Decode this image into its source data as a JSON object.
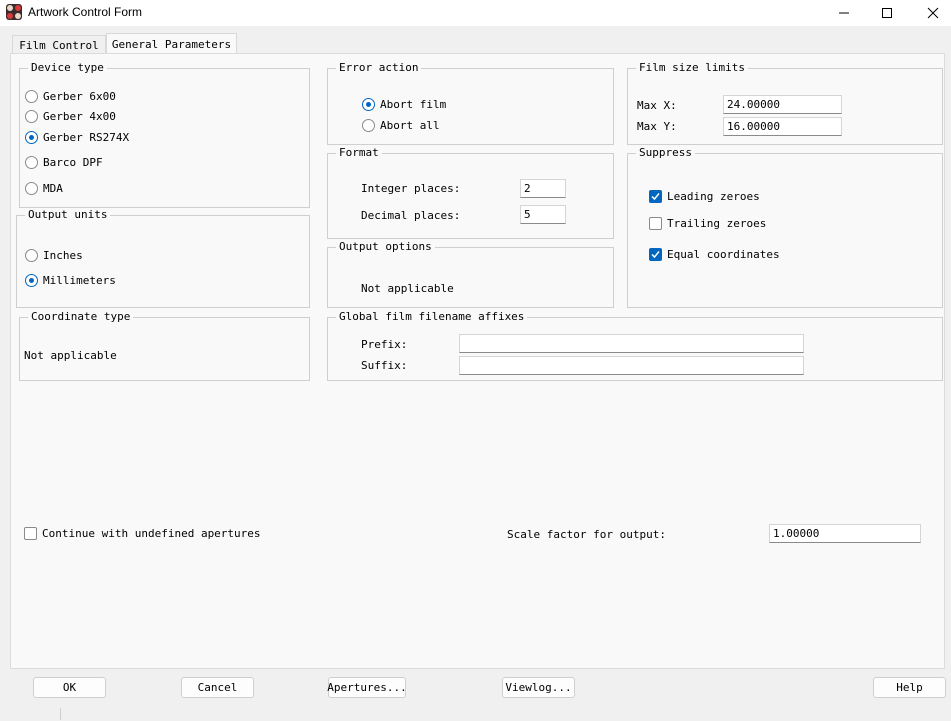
{
  "window": {
    "title": "Artwork Control Form",
    "icon": "app-logo-icon",
    "controls": [
      "minimize-icon",
      "maximize-icon",
      "close-icon"
    ]
  },
  "tabs": [
    {
      "label": "Film Control",
      "active": false
    },
    {
      "label": "General Parameters",
      "active": true
    }
  ],
  "device_type": {
    "label": "Device type",
    "options": [
      "Gerber 6x00",
      "Gerber 4x00",
      "Gerber RS274X",
      "Barco DPF",
      "MDA"
    ],
    "selected": "Gerber RS274X"
  },
  "output_units": {
    "label": "Output units",
    "options": [
      "Inches",
      "Millimeters"
    ],
    "selected": "Millimeters"
  },
  "coordinate_type": {
    "label": "Coordinate type",
    "value": "Not applicable"
  },
  "error_action": {
    "label": "Error action",
    "options": [
      "Abort film",
      "Abort all"
    ],
    "selected": "Abort film"
  },
  "format": {
    "label": "Format",
    "integer_label": "Integer places:",
    "integer_value": "2",
    "decimal_label": "Decimal places:",
    "decimal_value": "5"
  },
  "output_options": {
    "label": "Output options",
    "value": "Not applicable"
  },
  "film_size": {
    "label": "Film size limits",
    "max_x_label": "Max X:",
    "max_x_value": "24.00000",
    "max_y_label": "Max Y:",
    "max_y_value": "16.00000"
  },
  "suppress": {
    "label": "Suppress",
    "leading_label": "Leading zeroes",
    "leading_checked": true,
    "trailing_label": "Trailing zeroes",
    "trailing_checked": false,
    "equal_label": "Equal coordinates",
    "equal_checked": true
  },
  "affixes": {
    "label": "Global film filename affixes",
    "prefix_label": "Prefix:",
    "prefix_value": "",
    "suffix_label": "Suffix:",
    "suffix_value": ""
  },
  "continue_undefined": {
    "label": "Continue with undefined apertures",
    "checked": false
  },
  "scale": {
    "label": "Scale factor for output:",
    "value": "1.00000"
  },
  "buttons": {
    "ok": "OK",
    "cancel": "Cancel",
    "apertures": "Apertures...",
    "viewlog": "Viewlog...",
    "help": "Help"
  },
  "colors": {
    "accent": "#0067c0",
    "background": "#f0f0f0",
    "panel": "#f9f9f9"
  }
}
